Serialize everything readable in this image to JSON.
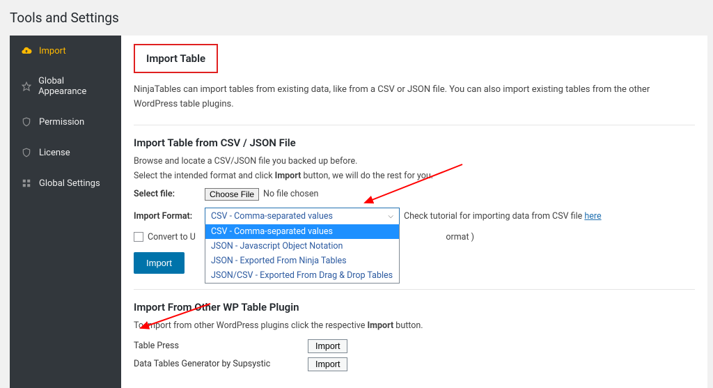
{
  "page": {
    "title": "Tools and Settings"
  },
  "sidebar": {
    "items": [
      {
        "label": "Import"
      },
      {
        "label": "Global Appearance"
      },
      {
        "label": "Permission"
      },
      {
        "label": "License"
      },
      {
        "label": "Global Settings"
      }
    ]
  },
  "main": {
    "heading": "Import Table",
    "intro": "NinjaTables can import tables from existing data, like from a CSV or JSON file. You can also import existing tables from the other WordPress table plugins.",
    "section1": {
      "title": "Import Table from CSV / JSON File",
      "instr1": "Browse and locate a CSV/JSON file you backed up before.",
      "instr2_a": "Select the intended format and click ",
      "instr2_bold": "Import",
      "instr2_b": " button, we will do the rest for you.",
      "select_file_label": "Select file:",
      "choose_btn": "Choose File",
      "no_file": "No file chosen",
      "format_label": "Import Format:",
      "format_selected": "CSV - Comma-separated values",
      "options": [
        "CSV - Comma-separated values",
        "JSON - Javascript Object Notation",
        "JSON - Exported From Ninja Tables",
        "JSON/CSV - Exported From Drag & Drop Tables"
      ],
      "hint_a": "Check tutorial for importing data from CSV file ",
      "hint_link": "here",
      "convert_label_a": "Convert to U",
      "convert_label_b": "ormat )",
      "import_btn": "Import"
    },
    "section2": {
      "title": "Import From Other WP Table Plugin",
      "instr_a": "To import from other WordPress plugins click the respective ",
      "instr_bold": "Import",
      "instr_b": " button.",
      "plugins": [
        {
          "name": "Table Press",
          "btn": "Import"
        },
        {
          "name": "Data Tables Generator by Supsystic",
          "btn": "Import"
        }
      ]
    }
  }
}
